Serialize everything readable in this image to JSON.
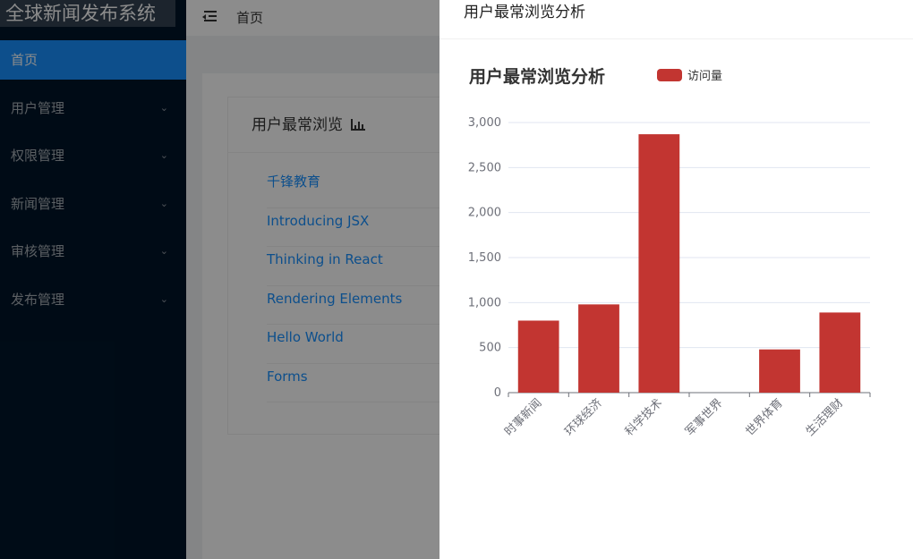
{
  "sidebar": {
    "logo": "全球新闻发布系统",
    "items": [
      {
        "label": "首页",
        "active": true,
        "has_children": false
      },
      {
        "label": "用户管理",
        "active": false,
        "has_children": true
      },
      {
        "label": "权限管理",
        "active": false,
        "has_children": true
      },
      {
        "label": "新闻管理",
        "active": false,
        "has_children": true
      },
      {
        "label": "审核管理",
        "active": false,
        "has_children": true
      },
      {
        "label": "发布管理",
        "active": false,
        "has_children": true
      }
    ]
  },
  "header": {
    "title": "首页",
    "fold_icon": "menu-fold-icon"
  },
  "card": {
    "title": "用户最常浏览",
    "icon": "bar-chart-icon",
    "links": [
      "千锋教育",
      "Introducing JSX",
      "Thinking in React",
      "Rendering Elements",
      "Hello World",
      "Forms"
    ]
  },
  "drawer": {
    "title": "用户最常浏览分析"
  },
  "chart_data": {
    "type": "bar",
    "title": "用户最常浏览分析",
    "legend": [
      "访问量"
    ],
    "legend_position": "top",
    "categories": [
      "时事新闻",
      "环球经济",
      "科学技术",
      "军事世界",
      "世界体育",
      "生活理财"
    ],
    "series": [
      {
        "name": "访问量",
        "values": [
          800,
          980,
          2870,
          0,
          480,
          890
        ]
      }
    ],
    "ylim": [
      0,
      3000
    ],
    "yticks": [
      "0",
      "500",
      "1,000",
      "1,500",
      "2,000",
      "2,500",
      "3,000"
    ],
    "grid": true,
    "color": "#c23531"
  }
}
